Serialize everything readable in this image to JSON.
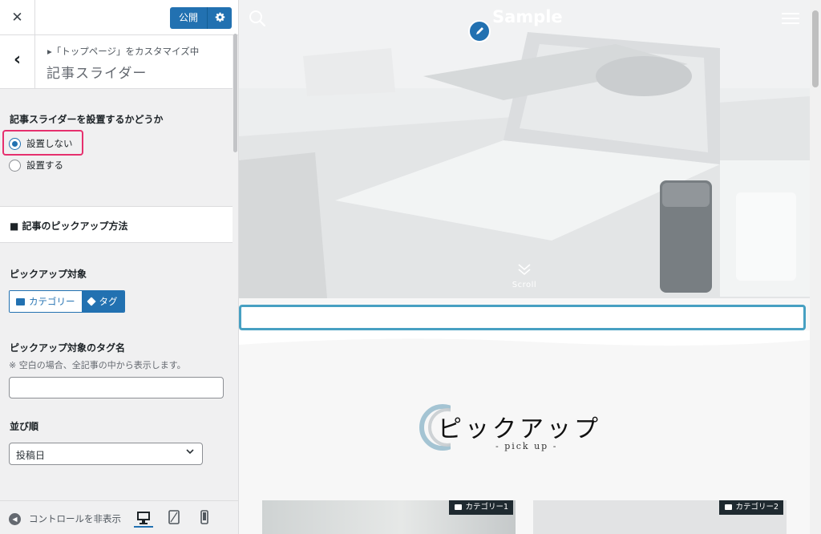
{
  "customizer": {
    "publish_label": "公開",
    "breadcrumb": "▸「トップページ」をカスタマイズ中",
    "section_title": "記事スライダー",
    "slider_question": "記事スライダーを設置するかどうか",
    "radio_options": [
      {
        "label": "設置しない",
        "selected": true
      },
      {
        "label": "設置する",
        "selected": false
      }
    ],
    "pickup_heading": "■ 記事のピックアップ方法",
    "pickup_target_label": "ピックアップ対象",
    "pickup_target_options": [
      {
        "label": "カテゴリー",
        "selected": false,
        "icon": "folder-icon"
      },
      {
        "label": "タグ",
        "selected": true,
        "icon": "tag-icon"
      }
    ],
    "tag_name_label": "ピックアップ対象のタグ名",
    "tag_name_hint": "※ 空白の場合、全記事の中から表示します。",
    "tag_name_value": "",
    "sort_label": "並び順",
    "sort_value": "投稿日",
    "collapse_label": "コントロールを非表示",
    "accent_color": "#2271b1",
    "highlight_color": "#e6306e"
  },
  "preview": {
    "site_title": "Sample",
    "scroll_label": "Scroll",
    "pickup_title": "ピックアップ",
    "pickup_subtitle": "- pick up -",
    "cards": [
      {
        "category": "カテゴリー1"
      },
      {
        "category": "カテゴリー2"
      }
    ],
    "notice_border_color": "#47a0c2"
  }
}
